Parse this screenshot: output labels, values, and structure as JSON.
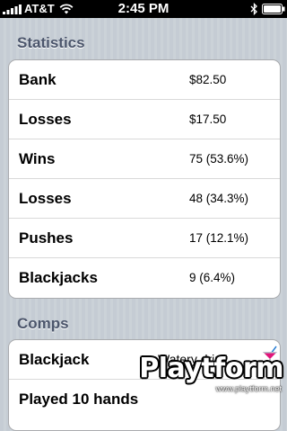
{
  "status_bar": {
    "carrier": "AT&T",
    "time": "2:45 PM",
    "icons": [
      "signal-bars-icon",
      "wifi-icon",
      "bluetooth-icon",
      "battery-icon"
    ]
  },
  "statistics": {
    "header": "Statistics",
    "rows": [
      {
        "label": "Bank",
        "value": "$82.50"
      },
      {
        "label": "Losses",
        "value": "$17.50"
      },
      {
        "label": "Wins",
        "value": "75 (53.6%)"
      },
      {
        "label": "Losses",
        "value": "48 (34.3%)"
      },
      {
        "label": "Pushes",
        "value": "17 (12.1%)"
      },
      {
        "label": "Blackjacks",
        "value": "9 (6.4%)"
      }
    ]
  },
  "comps": {
    "header": "Comps",
    "rows": [
      {
        "label": "Blackjack",
        "value": "Watery drink",
        "icon": "cocktail-icon"
      },
      {
        "label": "Played 10 hands",
        "value": ""
      }
    ]
  },
  "watermark": {
    "logo": "Playtform",
    "url": "www.playtform.net"
  }
}
